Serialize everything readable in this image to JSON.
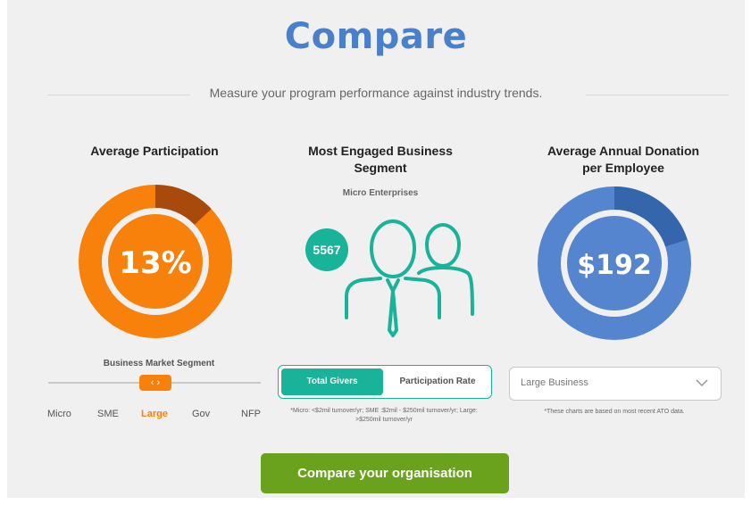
{
  "header": {
    "title": "Compare",
    "subtitle": "Measure your program performance against industry trends."
  },
  "participation": {
    "heading": "Average Participation",
    "value": "13%",
    "fraction": 0.13,
    "colors": {
      "main": "#f7810b",
      "accent": "#a84a0b",
      "inner": "#f0f0f0"
    },
    "segment_label": "Business Market Segment",
    "segments": [
      "Micro",
      "SME",
      "Large",
      "Gov",
      "NFP"
    ],
    "active_segment": "Large",
    "handle_glyphs": "‹ ›"
  },
  "engaged": {
    "heading_line1": "Most Engaged Business",
    "heading_line2": "Segment",
    "segment_name": "Micro Enterprises",
    "count": "5567",
    "icon": "business-people-icon",
    "toggle": {
      "active": "Total Givers",
      "inactive": "Participation Rate"
    },
    "note_line1": "*Micro: <$2mil turnover/yr; SME :$2mil - $250mil turnover/yr; Large:",
    "note_line2": ">$250mil turnover/yr"
  },
  "donation": {
    "heading_line1": "Average Annual Donation",
    "heading_line2": "per Employee",
    "value": "$192",
    "fraction": 0.2,
    "colors": {
      "main": "#5585cf",
      "accent": "#3566ab",
      "inner": "#f0f0f0"
    },
    "select_value": "Large Business",
    "note": "*These charts are based on most recent ATO data."
  },
  "cta": {
    "label": "Compare your organisation",
    "color": "#6aa21e"
  }
}
